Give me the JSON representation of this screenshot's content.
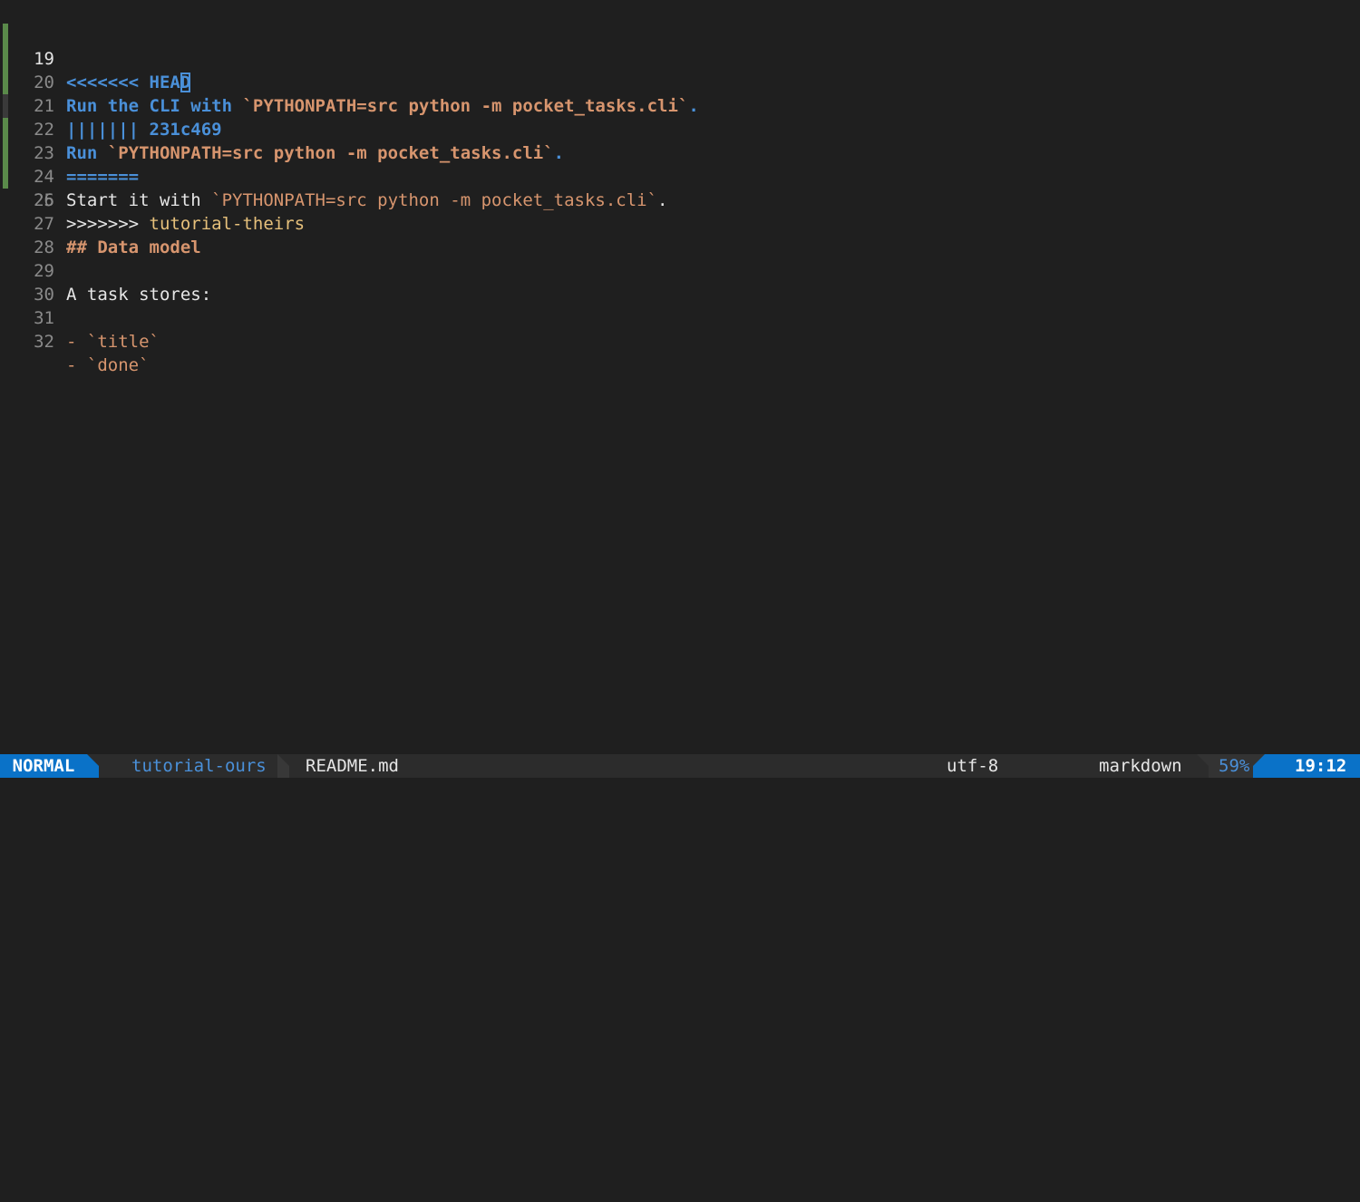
{
  "colors": {
    "background": "#1f1f1f",
    "accent_blue": "#4a90d9",
    "string_orange": "#d7956e",
    "branch_yellow": "#e6c07b",
    "mode_bg": "#0a72c8",
    "git_gutter": "#5a8a4a"
  },
  "editor": {
    "lines": [
      {
        "num": "19",
        "parts": [
          "<<<<<<< HEA",
          "D"
        ]
      },
      {
        "num": "20",
        "parts": [
          "Run the CLI with ",
          "`PYTHONPATH=src python -m pocket_tasks.cli`",
          "."
        ]
      },
      {
        "num": "21",
        "parts": [
          "||||||| 231c469"
        ]
      },
      {
        "num": "22",
        "parts": [
          "Run ",
          "`PYTHONPATH=src python -m pocket_tasks.cli`",
          "."
        ]
      },
      {
        "num": "23",
        "parts": [
          "======="
        ]
      },
      {
        "num": "24",
        "parts": [
          "Start it with ",
          "`PYTHONPATH=src python -m pocket_tasks.cli`",
          "."
        ]
      },
      {
        "num": "25",
        "parts": [
          ">>>>>>> ",
          "tutorial-theirs"
        ]
      },
      {
        "num": "26",
        "parts": [
          ""
        ]
      },
      {
        "num": "27",
        "parts": [
          "## Data model"
        ]
      },
      {
        "num": "28",
        "parts": [
          ""
        ]
      },
      {
        "num": "29",
        "parts": [
          "A task stores:"
        ]
      },
      {
        "num": "30",
        "parts": [
          ""
        ]
      },
      {
        "num": "31",
        "parts": [
          "- ",
          "`title`"
        ]
      },
      {
        "num": "32",
        "parts": [
          "- ",
          "`done`"
        ]
      }
    ]
  },
  "statusbar": {
    "mode": "NORMAL",
    "branch_icon": "git-branch-icon",
    "branch": "tutorial-ours",
    "filename": "README.md",
    "encoding": "utf-8",
    "os_icon": "linux-icon",
    "filetype_icon": "file-icon",
    "filetype": "markdown",
    "percent": "59%",
    "position": "19:12"
  }
}
